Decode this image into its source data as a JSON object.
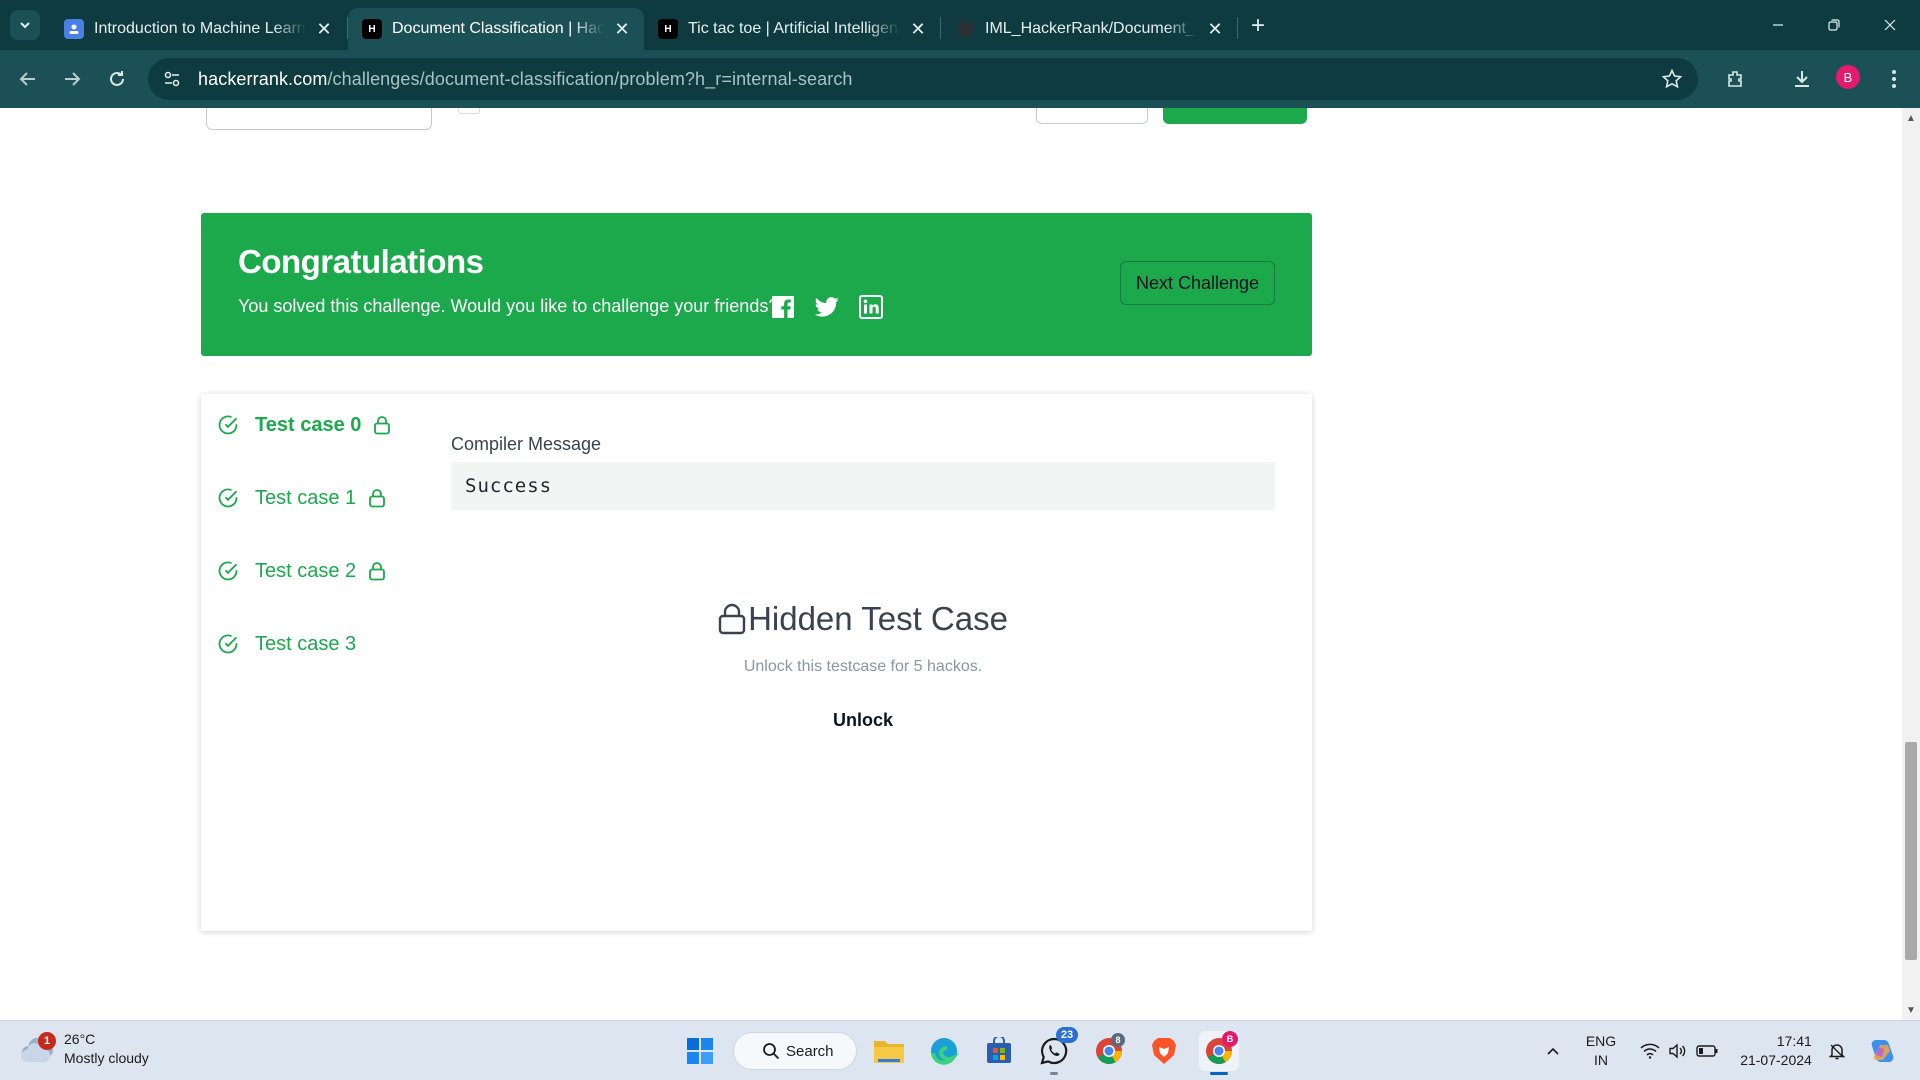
{
  "browser": {
    "tabs": [
      {
        "title": "Introduction to Machine Learnin",
        "favicon": "classroom-icon",
        "active": false
      },
      {
        "title": "Document Classification | Hacke",
        "favicon": "hackerrank-icon",
        "active": true
      },
      {
        "title": "Tic tac toe | Artificial Intelligence",
        "favicon": "hackerrank-icon",
        "active": false
      },
      {
        "title": "IML_HackerRank/Document_Cla",
        "favicon": "github-icon",
        "active": false
      }
    ],
    "url_host": "hackerrank.com",
    "url_path": "/challenges/document-classification/problem?h_r=internal-search",
    "profile_initial": "B"
  },
  "congrats": {
    "title": "Congratulations",
    "message": "You solved this challenge. Would you like to challenge your friends?",
    "next_label": "Next Challenge"
  },
  "test_cases": [
    {
      "label": "Test case 0",
      "locked": true,
      "active": true
    },
    {
      "label": "Test case 1",
      "locked": true,
      "active": false
    },
    {
      "label": "Test case 2",
      "locked": true,
      "active": false
    },
    {
      "label": "Test case 3",
      "locked": false,
      "active": false
    }
  ],
  "compiler": {
    "label": "Compiler Message",
    "message": "Success"
  },
  "hidden": {
    "title": "Hidden Test Case",
    "subtitle": "Unlock this testcase for 5 hackos.",
    "unlock_label": "Unlock"
  },
  "taskbar": {
    "weather_badge": "1",
    "temperature": "26°C",
    "condition": "Mostly cloudy",
    "search_label": "Search",
    "whatsapp_badge": "23",
    "chrome_badge": "8",
    "chrome2_badge": "B",
    "lang_line1": "ENG",
    "lang_line2": "IN",
    "time": "17:41",
    "date": "21-07-2024"
  },
  "colors": {
    "hackerrank_green": "#1ba94c",
    "chrome_frame": "#0e3b3f",
    "chrome_toolbar": "#1b5156"
  }
}
